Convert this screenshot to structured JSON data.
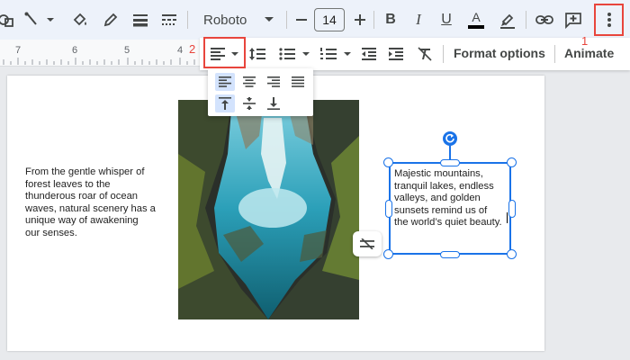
{
  "toolbar": {
    "font_name": "Roboto",
    "font_size": "14",
    "bold_label": "B",
    "italic_label": "I",
    "underline_label": "U",
    "text_color_letter": "A",
    "text_color": "#000000"
  },
  "format_bar": {
    "format_options_label": "Format options",
    "animate_label": "Animate"
  },
  "ruler": {
    "numbers": [
      "7",
      "6",
      "5",
      "4"
    ]
  },
  "slide": {
    "left_text_lines": [
      "From the gentle whisper of",
      "forest leaves to the",
      "thunderous roar of ocean",
      "waves, natural scenery has a",
      "unique way of awakening",
      "our senses."
    ],
    "textbox_lines": [
      "Majestic mountains,",
      "tranquil lakes, endless",
      "valleys, and golden",
      "sunsets remind us of",
      "the world’s quiet beauty."
    ]
  },
  "annotations": {
    "marker_1": "1",
    "marker_2": "2"
  },
  "colors": {
    "accent": "#1a73e8",
    "highlight": "#e8453c",
    "selected_bg": "#d3e3fd"
  }
}
